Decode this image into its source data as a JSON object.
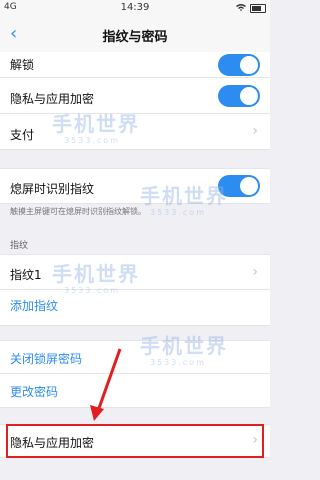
{
  "status": {
    "signal": "4G",
    "time": "14:39"
  },
  "nav": {
    "back": "‹",
    "title": "指纹与密码"
  },
  "rows": {
    "unlock": "解锁",
    "privacy": "隐私与应用加密",
    "pay": "支付",
    "screenoff": "熄屏时识别指纹",
    "screenoff_hint": "触摸主屏键可在熄屏时识别指纹解锁。",
    "fingerprint_section": "指纹",
    "fingerprint1": "指纹1",
    "add_fingerprint": "添加指纹",
    "close_lock_pwd": "关闭锁屏密码",
    "change_pwd": "更改密码",
    "privacy_bottom": "隐私与应用加密"
  },
  "watermark": {
    "text": "手机世界",
    "num": "3533.com"
  }
}
